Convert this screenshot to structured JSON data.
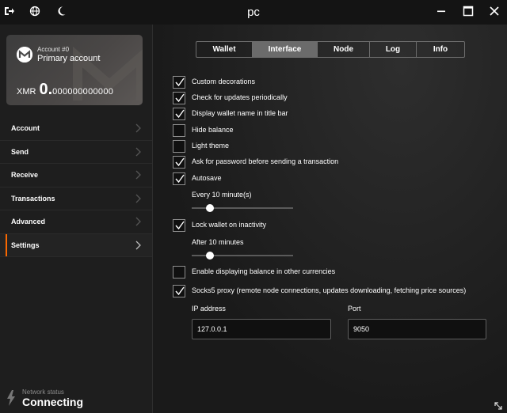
{
  "window": {
    "title": "pc"
  },
  "titlebar_icons": {
    "left": [
      "exit-icon",
      "globe-icon",
      "moon-icon"
    ],
    "right": [
      "minimize-icon",
      "maximize-icon",
      "close-icon"
    ]
  },
  "account": {
    "number": "Account #0",
    "name": "Primary account",
    "currency": "XMR",
    "balance_int": "0.",
    "balance_dec": "000000000000"
  },
  "menu": [
    {
      "label": "Account",
      "active": false
    },
    {
      "label": "Send",
      "active": false
    },
    {
      "label": "Receive",
      "active": false
    },
    {
      "label": "Transactions",
      "active": false
    },
    {
      "label": "Advanced",
      "active": false
    },
    {
      "label": "Settings",
      "active": true
    }
  ],
  "network": {
    "label": "Network status",
    "value": "Connecting"
  },
  "tabs": [
    {
      "label": "Wallet",
      "active": false
    },
    {
      "label": "Interface",
      "active": true
    },
    {
      "label": "Node",
      "active": false
    },
    {
      "label": "Log",
      "active": false
    },
    {
      "label": "Info",
      "active": false
    }
  ],
  "options": [
    {
      "label": "Custom decorations",
      "checked": true
    },
    {
      "label": "Check for updates periodically",
      "checked": true
    },
    {
      "label": "Display wallet name in title bar",
      "checked": true
    },
    {
      "label": "Hide balance",
      "checked": false
    },
    {
      "label": "Light theme",
      "checked": false
    },
    {
      "label": "Ask for password before sending a transaction",
      "checked": true
    },
    {
      "label": "Autosave",
      "checked": true
    }
  ],
  "autosave": {
    "interval_label": "Every 10 minute(s)",
    "slider_value": 10
  },
  "lock": {
    "label": "Lock wallet on inactivity",
    "checked": true,
    "interval_label": "After 10 minutes",
    "slider_value": 10
  },
  "currency_option": {
    "label": "Enable displaying balance in other currencies",
    "checked": false
  },
  "proxy": {
    "label": "Socks5 proxy (remote node connections, updates downloading, fetching price sources)",
    "checked": true,
    "ip_label": "IP address",
    "ip_value": "127.0.0.1",
    "port_label": "Port",
    "port_value": "9050"
  },
  "colors": {
    "accent": "#fa6800",
    "background": "#1a1a1a",
    "active_tab": "#6b6b6b"
  }
}
